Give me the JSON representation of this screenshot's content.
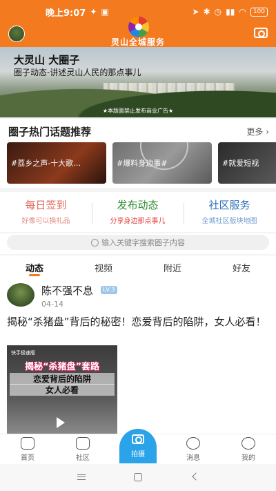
{
  "status_bar": {
    "time": "晚上9:07",
    "battery": "100"
  },
  "header": {
    "app_title": "灵山全城服务"
  },
  "banner": {
    "title": "大灵山 大圈子",
    "subtitle": "圈子动态-讲述灵山人民的那点事儿",
    "note": "★本版面禁止发布商业广告★"
  },
  "hot_topics": {
    "title": "圈子热门话题推荐",
    "more": "更多",
    "items": [
      {
        "label": "#荔乡之声-十大歌…"
      },
      {
        "label": "#爆料身边事#"
      },
      {
        "label": "#就爱短视"
      }
    ]
  },
  "quick_actions": [
    {
      "title": "每日签到",
      "subtitle": "好像可以换礼品"
    },
    {
      "title": "发布动态",
      "subtitle": "分享身边那点事儿"
    },
    {
      "title": "社区服务",
      "subtitle": "全城社区版块地图"
    }
  ],
  "search": {
    "placeholder": "输入关键字搜索圈子内容"
  },
  "tabs": [
    {
      "label": "动态"
    },
    {
      "label": "视频"
    },
    {
      "label": "附近"
    },
    {
      "label": "好友"
    }
  ],
  "post": {
    "username": "陈不强不息",
    "level": "LV.3",
    "date": "04-14",
    "text": "揭秘“杀猪盘”背后的秘密！恋爱背后的陷阱，女人必看！",
    "video": {
      "tag": "快手极速版",
      "caption1": "揭秘“杀猪盘”套路",
      "caption2": "恋爱背后的陷阱",
      "caption3": "女人必看"
    }
  },
  "bottom_nav": [
    {
      "label": "首页",
      "icon": "home-icon"
    },
    {
      "label": "社区",
      "icon": "community-icon"
    },
    {
      "label": "拍摄",
      "icon": "camera-icon"
    },
    {
      "label": "消息",
      "icon": "message-icon"
    },
    {
      "label": "我的",
      "icon": "profile-icon"
    }
  ],
  "colors": {
    "brand_orange": "#f47a1f",
    "accent_blue": "#2aa3e8"
  }
}
